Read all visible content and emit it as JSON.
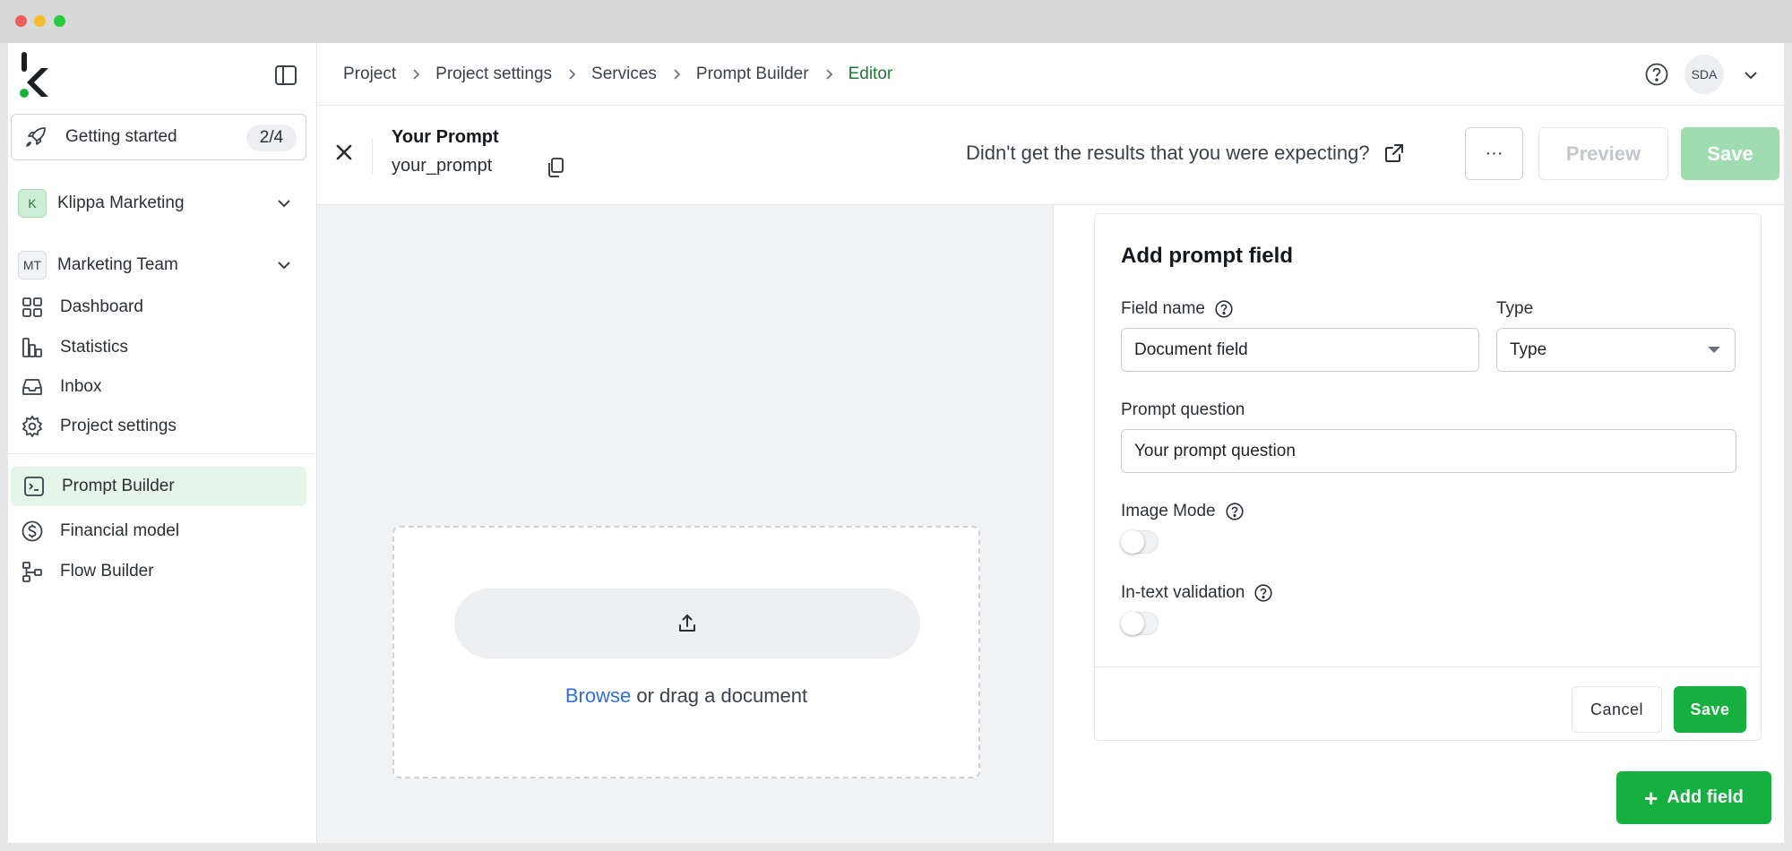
{
  "colors": {
    "brand_green": "#16b040",
    "brand_green_disabled": "#9fdcb0",
    "active_nav_bg": "#e6f5e9",
    "current_crumb": "#1d7a35",
    "link_blue": "#2f6fe0"
  },
  "sidebar": {
    "logo_icon": "klippa-logo-icon",
    "getting_started": {
      "label": "Getting started",
      "progress": "2/4",
      "icon": "rocket-icon"
    },
    "organization": {
      "avatar": "K",
      "name": "Klippa Marketing"
    },
    "team": {
      "avatar": "MT",
      "name": "Marketing Team"
    },
    "items": [
      {
        "label": "Dashboard",
        "icon": "dashboard-grid-icon"
      },
      {
        "label": "Statistics",
        "icon": "bar-chart-icon"
      },
      {
        "label": "Inbox",
        "icon": "inbox-icon"
      },
      {
        "label": "Project settings",
        "icon": "gear-icon"
      },
      {
        "label": "Prompt Builder",
        "icon": "terminal-icon",
        "active": true
      },
      {
        "label": "Financial model",
        "icon": "dollar-circle-icon"
      },
      {
        "label": "Flow Builder",
        "icon": "flow-icon"
      }
    ]
  },
  "breadcrumb": [
    "Project",
    "Project settings",
    "Services",
    "Prompt Builder",
    "Editor"
  ],
  "user": {
    "initials": "SDA"
  },
  "header": {
    "title": "Your Prompt",
    "slug": "your_prompt",
    "feedback_link": "Didn't get the results that you were expecting?",
    "more_label": "···",
    "preview_label": "Preview",
    "save_label": "Save"
  },
  "dropzone": {
    "browse_label": "Browse",
    "rest_label": " or drag a document"
  },
  "form": {
    "title": "Add prompt field",
    "field_name_label": "Field name",
    "field_name_value": "Document field",
    "type_label": "Type",
    "type_value": "Type",
    "prompt_question_label": "Prompt question",
    "prompt_question_value": "Your prompt question",
    "image_mode_label": "Image Mode",
    "image_mode_on": false,
    "in_text_validation_label": "In-text validation",
    "in_text_validation_on": false,
    "cancel_label": "Cancel",
    "save_label": "Save"
  },
  "add_field_label": "Add field"
}
